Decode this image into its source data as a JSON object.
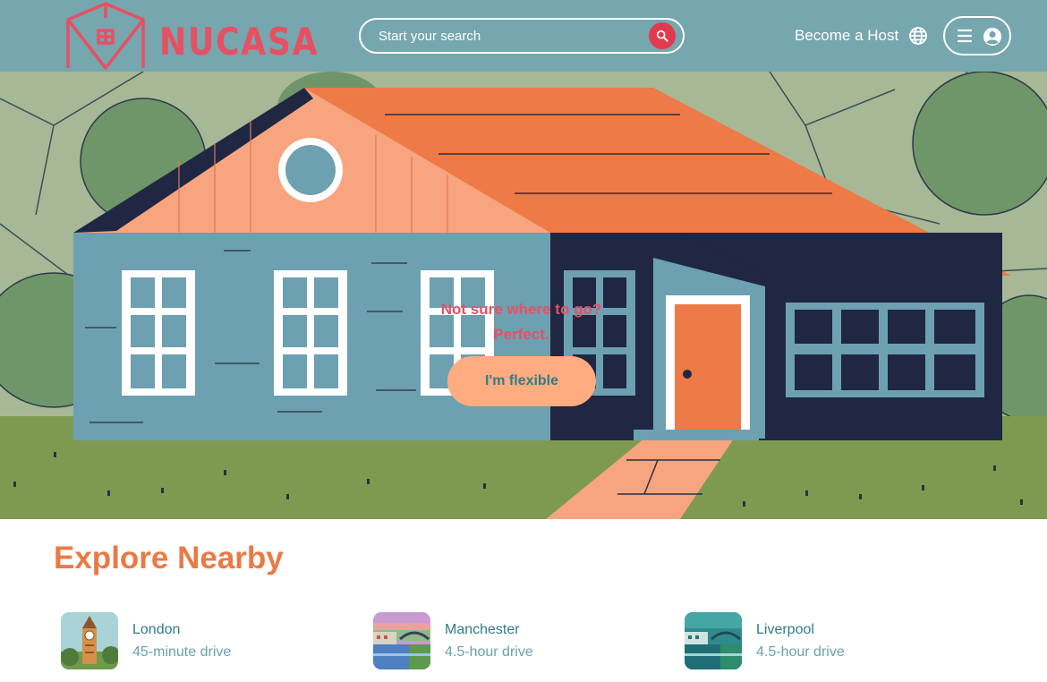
{
  "brand": {
    "name": "NUCASA"
  },
  "header": {
    "search_placeholder": "Start your search",
    "become_host": "Become a Host"
  },
  "hero": {
    "line1": "Not sure where to go?",
    "line2": "Perfect.",
    "button": "I'm flexible"
  },
  "explore": {
    "title": "Explore Nearby",
    "items": [
      {
        "city": "London",
        "distance": "45-minute drive"
      },
      {
        "city": "Manchester",
        "distance": "4.5-hour drive"
      },
      {
        "city": "Liverpool",
        "distance": "4.5-hour drive"
      }
    ]
  },
  "colors": {
    "header_bg": "#76a6ae",
    "brand_red": "#e65063",
    "accent_orange": "#ea7a45",
    "button_peach": "#ffac80",
    "teal_text": "#2f7d86"
  },
  "icons": [
    "search-icon",
    "globe-icon",
    "hamburger-icon",
    "user-circle-icon"
  ]
}
